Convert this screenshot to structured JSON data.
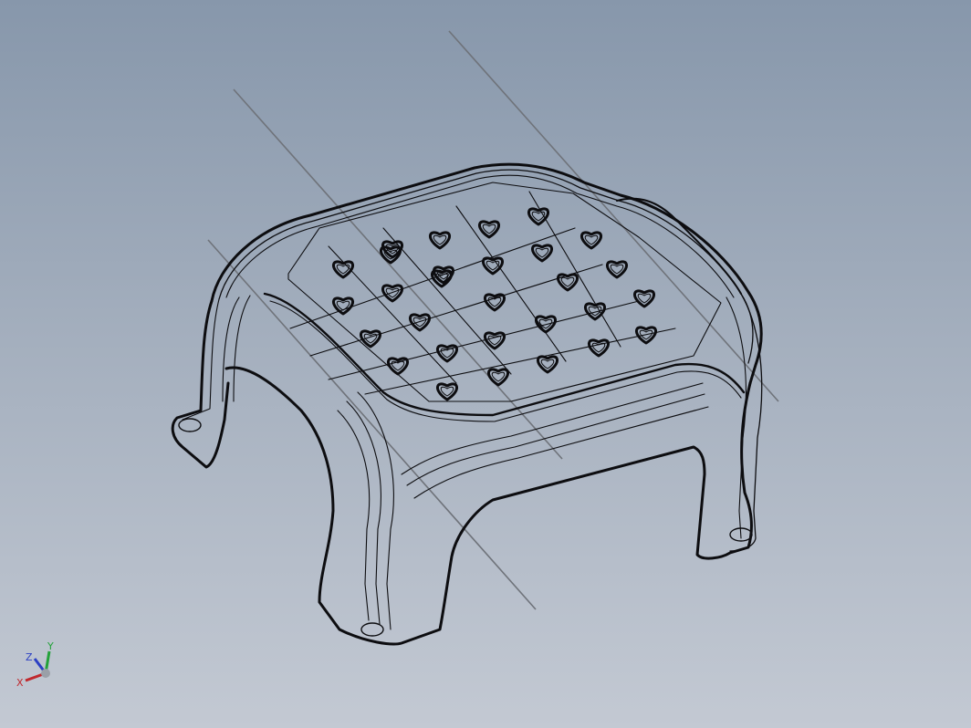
{
  "viewport": {
    "background_top": "#8797ab",
    "background_bottom": "#c3c9d3",
    "edge_color": "#0d0d10",
    "axis_line_color": "#6f737a"
  },
  "model": {
    "name": "stool-wireframe",
    "heart_cutout_count": 29
  },
  "triad": {
    "x_label": "X",
    "y_label": "Y",
    "z_label": "Z",
    "x_color": "#c0282d",
    "y_color": "#23a23a",
    "z_color": "#2b3fc4"
  }
}
